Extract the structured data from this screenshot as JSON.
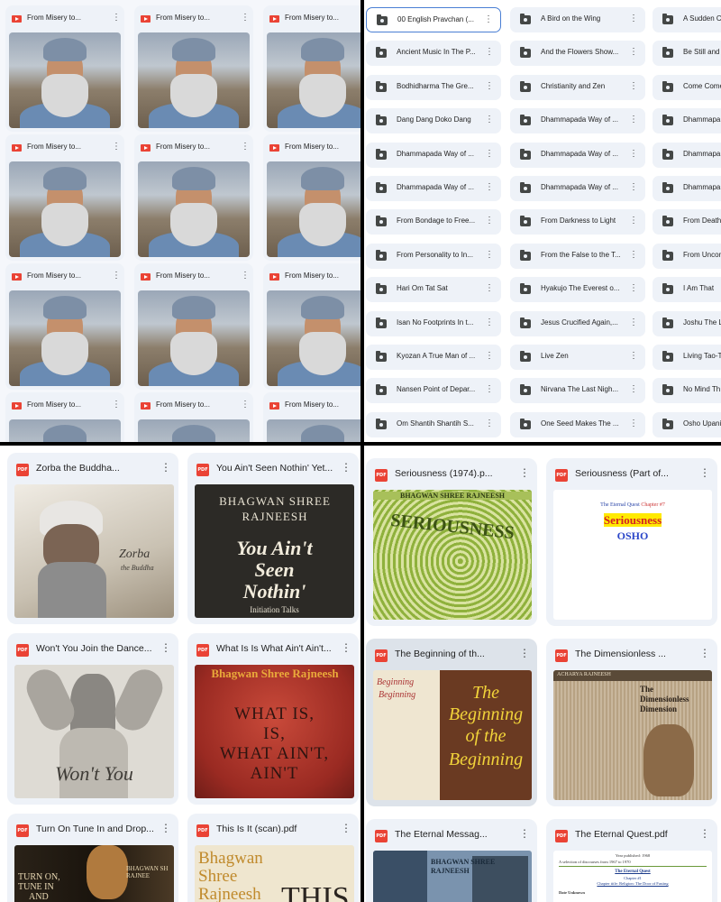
{
  "video_grid": {
    "cards": [
      {
        "title": "From Misery to..."
      },
      {
        "title": "From Misery to..."
      },
      {
        "title": "From Misery to..."
      },
      {
        "title": "From Misery to..."
      },
      {
        "title": "From Misery to..."
      },
      {
        "title": "From Misery to..."
      },
      {
        "title": "From Misery to..."
      },
      {
        "title": "From Misery to..."
      },
      {
        "title": "From Misery to..."
      },
      {
        "title": "From Misery to..."
      },
      {
        "title": "From Misery to..."
      },
      {
        "title": "From Misery to..."
      }
    ],
    "icon": "video-icon"
  },
  "folder_grid": {
    "icon": "shared-folder-icon",
    "rows": [
      [
        "00 English Pravchan (...",
        "A Bird on the Wing",
        "A Sudden C"
      ],
      [
        "Ancient Music In The P...",
        "And the Flowers Show...",
        "Be Still and"
      ],
      [
        "Bodhidharma The Gre...",
        "Christianity and Zen",
        "Come Come"
      ],
      [
        "Dang Dang Doko Dang",
        "Dhammapada Way of ...",
        "Dhammapa"
      ],
      [
        "Dhammapada Way of ...",
        "Dhammapada Way of ...",
        "Dhammapa"
      ],
      [
        "Dhammapada Way of ...",
        "Dhammapada Way of ...",
        "Dhammapa"
      ],
      [
        "From Bondage to Free...",
        "From Darkness to Light",
        "From Death"
      ],
      [
        "From Personality to In...",
        "From the False to the T...",
        "From Uncon"
      ],
      [
        "Hari Om Tat Sat",
        "Hyakujo The Everest o...",
        "I Am That"
      ],
      [
        "Isan No Footprints In t...",
        "Jesus Crucified Again,...",
        "Joshu The L"
      ],
      [
        "Kyozan A True Man of ...",
        "Live Zen",
        "Living Tao-T"
      ],
      [
        "Nansen Point of Depar...",
        "Nirvana The Last Nigh...",
        "No Mind Th"
      ],
      [
        "Om Shantih Shantih S...",
        "One Seed Makes The ...",
        "Osho Upani"
      ]
    ]
  },
  "pdf_left": {
    "cards": [
      {
        "title": "Zorba the Buddha...",
        "cover": {
          "lines": [
            "Zorba",
            "the Buddha"
          ]
        }
      },
      {
        "title": "You Ain't Seen Nothin' Yet...",
        "cover": {
          "author": "BHAGWAN SHREE RAJNEESH",
          "lines": [
            "You Ain't",
            "Seen",
            "Nothin'"
          ],
          "footer": "Initiation Talks"
        }
      },
      {
        "title": "Won't You Join the Dance...",
        "cover": {
          "lines": [
            "Won't You"
          ]
        }
      },
      {
        "title": "What Is Is What Ain't Ain't...",
        "cover": {
          "author": "Bhagwan Shree Rajneesh",
          "lines": [
            "WHAT IS,",
            "IS,",
            "WHAT AIN'T,",
            "AIN'T"
          ]
        }
      },
      {
        "title": "Turn On Tune In and Drop...",
        "cover": {
          "lines": [
            "TURN ON,",
            "TUNE IN",
            "AND"
          ],
          "author": "BHAGWAN SH RAJNEE"
        }
      },
      {
        "title": "This Is It (scan).pdf",
        "cover": {
          "lines": [
            "Bhagwan",
            "Shree",
            "Rajneesh"
          ],
          "big": "THIS"
        }
      }
    ]
  },
  "pdf_right": {
    "cards": [
      {
        "title": "Seriousness (1974).p...",
        "cover": {
          "author": "BHAGWAN SHREE RAJNEESH",
          "lines": [
            "SERIOUSNESS"
          ]
        }
      },
      {
        "title": "Seriousness (Part of...",
        "cover": {
          "header": "The Eternal Quest",
          "header_sub": "Chapter #7",
          "lines": [
            "Seriousness",
            "OSHO"
          ]
        }
      },
      {
        "title": "The Beginning of th...",
        "cover": {
          "lines": [
            "The",
            "Beginning",
            "of the",
            "Beginning"
          ],
          "left_lines": [
            "Beginning",
            "Beginning"
          ]
        }
      },
      {
        "title": "The Dimensionless ...",
        "cover": {
          "author": "ACHARYA RAJNEESH",
          "lines": [
            "The",
            "Dimensionless",
            "Dimension"
          ]
        }
      },
      {
        "title": "The Eternal Messag...",
        "cover": {
          "author": "BHAGWAN SHREE RAJNEESH"
        }
      },
      {
        "title": "The Eternal Quest.pdf",
        "cover": {
          "header": "Year published: 1968",
          "sub": "A selection of discourses from 1967 to 1970",
          "lines": [
            "The Eternal Quest",
            "Chapter #1",
            "Chapter title: Religion: The Door of Fasting"
          ],
          "footer": "Date Unknown"
        }
      }
    ]
  },
  "colors": {
    "chip_bg": "#eef2f8",
    "selected_border": "#4a7fd4",
    "pdf_red": "#ea4335",
    "video_red": "#ea4335"
  }
}
